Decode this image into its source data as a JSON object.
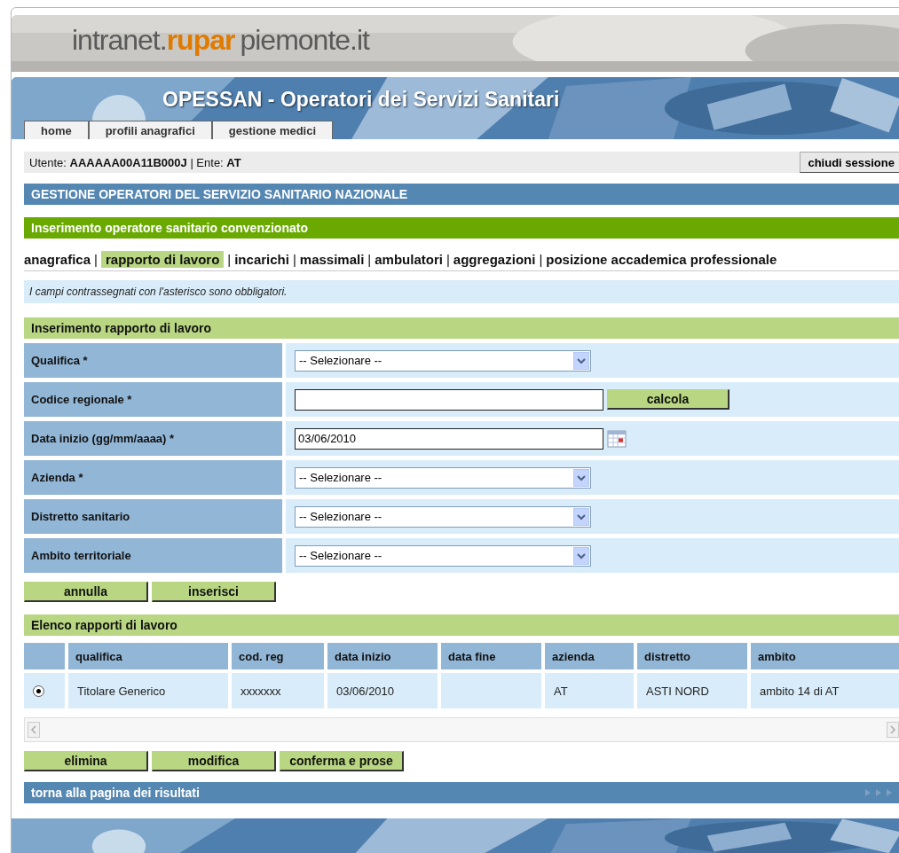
{
  "logo": {
    "prefix": "intranet.",
    "brand": "rupar",
    "suffix": "piemonte.it"
  },
  "app_title": "OPESSAN - Operatori dei Servizi Sanitari",
  "nav_tabs": [
    {
      "label": "home"
    },
    {
      "label": "profili anagrafici"
    },
    {
      "label": "gestione medici"
    }
  ],
  "user_bar": {
    "text": "Utente: **AAAAAA00A11B000J** | Ente: **AT**",
    "logout_button": "chiudi sessione"
  },
  "section_title": "GESTIONE OPERATORI DEL SERVIZIO SANITARIO NAZIONALE",
  "page_title": "Inserimento operatore sanitario convenzionato",
  "tab_separator": "|",
  "sub_tabs": [
    {
      "label": "anagrafica",
      "selected": false
    },
    {
      "label": "rapporto di lavoro",
      "selected": true
    },
    {
      "label": "incarichi",
      "selected": false
    },
    {
      "label": "massimali",
      "selected": false
    },
    {
      "label": "ambulatori",
      "selected": false
    },
    {
      "label": "aggregazioni",
      "selected": false
    },
    {
      "label": "posizione accademica professionale",
      "selected": false
    }
  ],
  "note": "I campi contrassegnati con l'asterisco sono obbligatori.",
  "form": {
    "title": "Inserimento rapporto di lavoro",
    "fields": [
      {
        "label": "Qualifica *",
        "kind": "select",
        "value": "-- Selezionare --"
      },
      {
        "label": "Codice regionale *",
        "kind": "text_button",
        "button": "calcola"
      },
      {
        "label": "Data inizio (gg/mm/aaaa) *",
        "kind": "date",
        "value": "03/06/2010"
      },
      {
        "label": "Azienda *",
        "kind": "select",
        "value": "-- Selezionare --"
      },
      {
        "label": "Distretto sanitario",
        "kind": "select",
        "value": "-- Selezionare --"
      },
      {
        "label": "Ambito territoriale",
        "kind": "select",
        "value": "-- Selezionare --"
      }
    ],
    "buttons": [
      "annulla",
      "inserisci"
    ]
  },
  "list": {
    "title": "Elenco rapporti di lavoro",
    "columns": [
      "qualifica",
      "cod. reg",
      "data inizio",
      "data fine",
      "azienda",
      "distretto",
      "ambito"
    ],
    "rows": [
      {
        "selected": true,
        "cells": [
          "Titolare Generico",
          "xxxxxxx",
          "03/06/2010",
          "",
          "AT",
          "ASTI NORD",
          "ambito 14 di AT"
        ]
      }
    ],
    "buttons": [
      "elimina",
      "modifica",
      "conferma e prose"
    ]
  },
  "footer_link": "torna alla pagina dei risultati"
}
